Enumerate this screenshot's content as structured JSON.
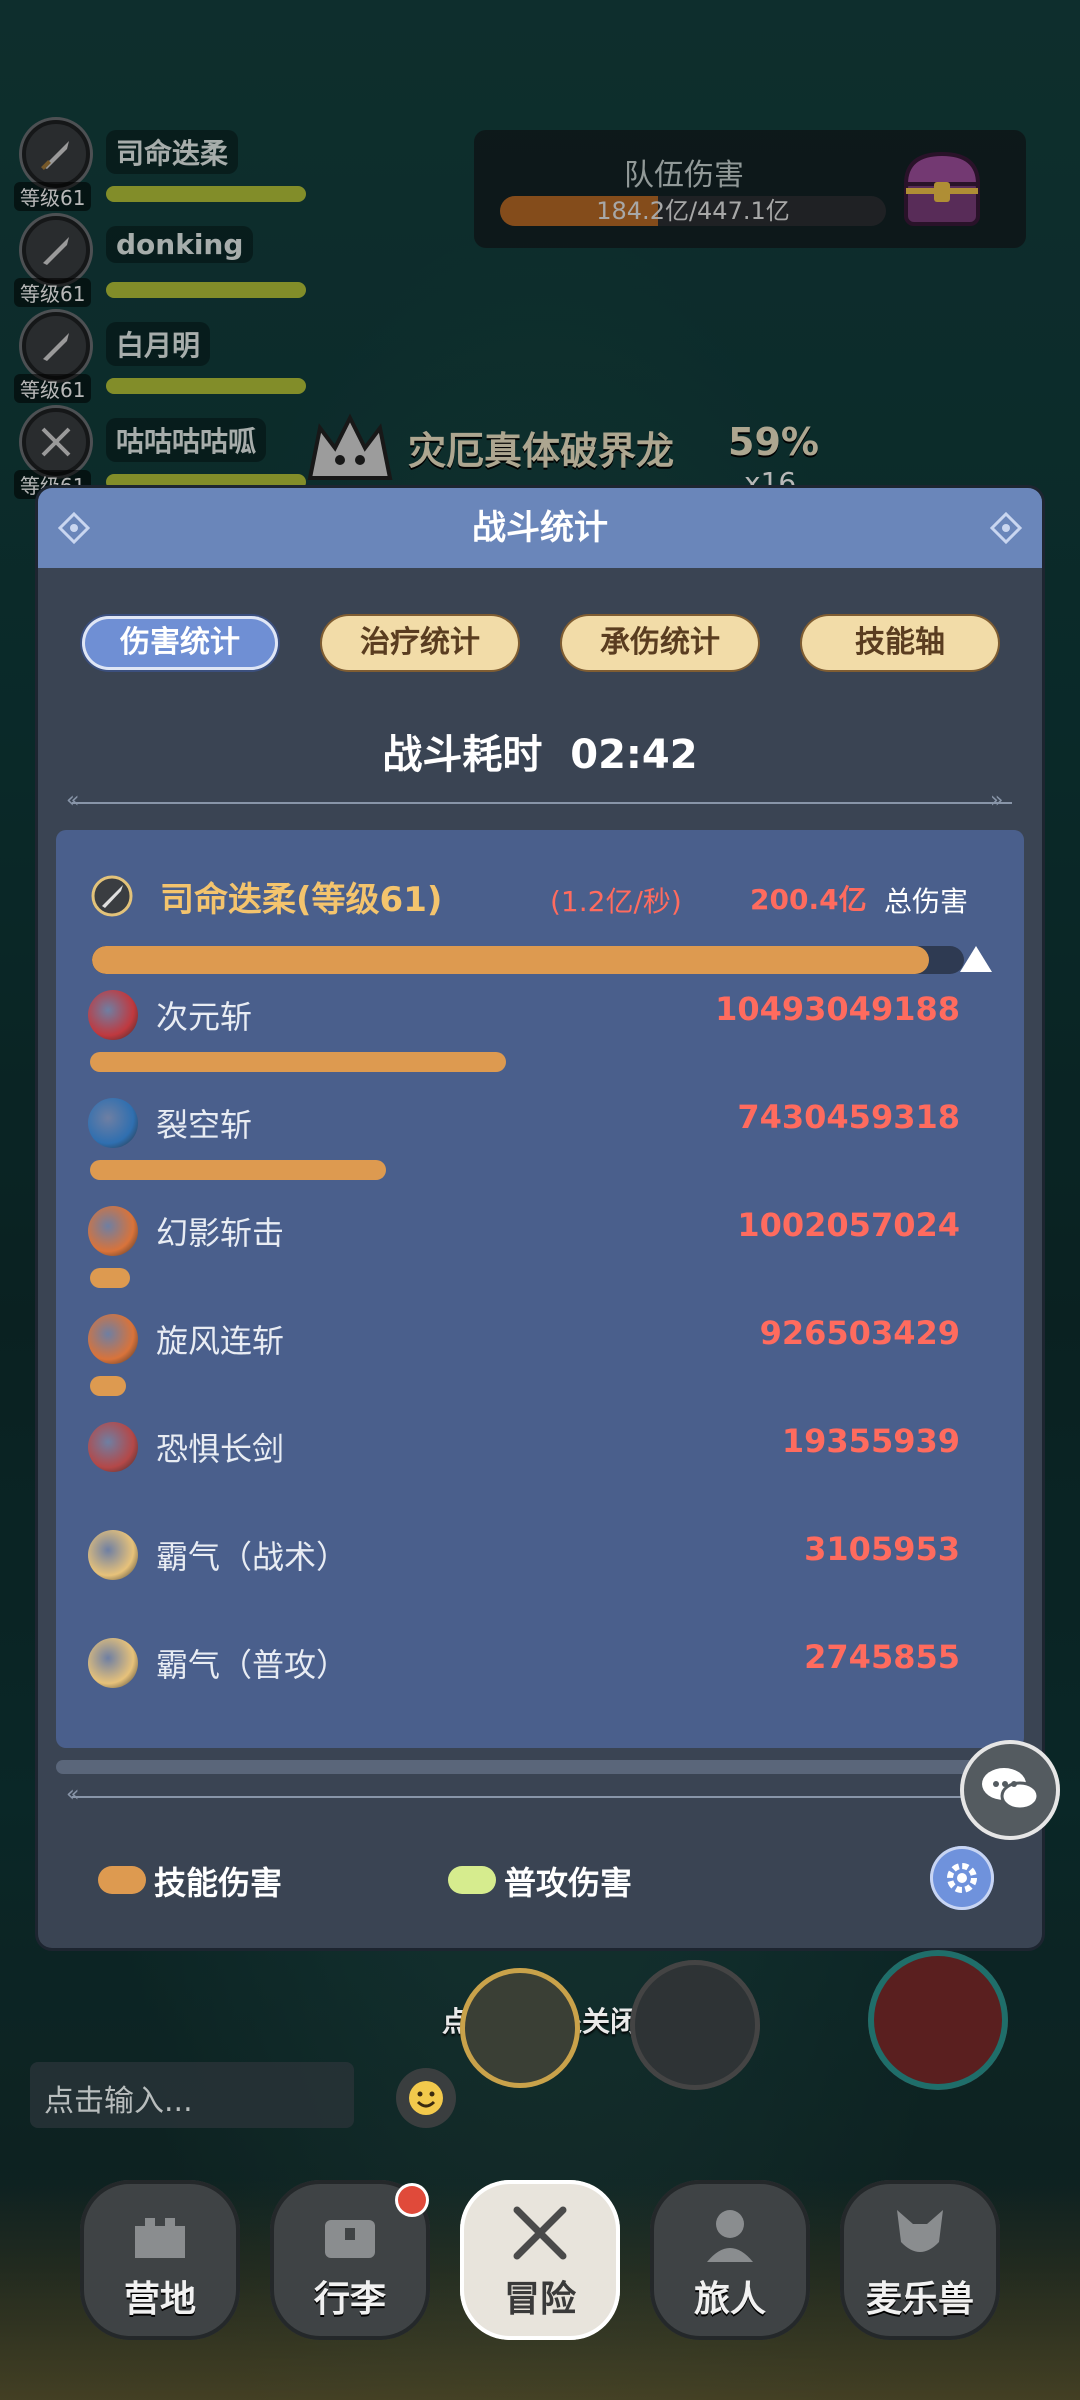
{
  "party": [
    {
      "name": "司命迭柔",
      "level": "等级61"
    },
    {
      "name": "donking",
      "level": "等级61"
    },
    {
      "name": "白月明",
      "level": "等级61"
    },
    {
      "name": "咕咕咕咕呱",
      "level": "等级61"
    }
  ],
  "team_damage": {
    "title": "队伍伤害",
    "value": "184.2亿/447.1亿",
    "progress": 0.41
  },
  "boss": {
    "name": "灾厄真体破界龙",
    "percent": "59%",
    "count": "x16"
  },
  "modal": {
    "title": "战斗统计",
    "tabs": [
      {
        "label": "伤害统计",
        "active": true
      },
      {
        "label": "治疗统计",
        "active": false
      },
      {
        "label": "承伤统计",
        "active": false
      },
      {
        "label": "技能轴",
        "active": false
      }
    ],
    "duration_label": "战斗耗时",
    "duration_value": "02:42",
    "player": {
      "name": "司命迭柔(等级61)",
      "rate": "(1.2亿/秒)",
      "total": "200.4亿",
      "total_label": "总伤害",
      "progress": 0.96
    },
    "skills": [
      {
        "name": "次元斩",
        "value": "10493049188",
        "ratio": 0.52,
        "icon": "dimension-slash-icon"
      },
      {
        "name": "裂空斩",
        "value": "7430459318",
        "ratio": 0.37,
        "icon": "rift-slash-icon"
      },
      {
        "name": "幻影斩击",
        "value": "1002057024",
        "ratio": 0.05,
        "icon": "phantom-strike-icon"
      },
      {
        "name": "旋风连斩",
        "value": "926503429",
        "ratio": 0.045,
        "icon": "whirlwind-slash-icon"
      },
      {
        "name": "恐惧长剑",
        "value": "19355939",
        "ratio": 0,
        "icon": "dread-sword-icon"
      },
      {
        "name": "霸气（战术）",
        "value": "3105953",
        "ratio": 0,
        "icon": "dominance-tactic-icon"
      },
      {
        "name": "霸气（普攻）",
        "value": "2745855",
        "ratio": 0,
        "icon": "dominance-attack-icon"
      }
    ],
    "legend": [
      {
        "label": "技能伤害",
        "color": "#dd9a50"
      },
      {
        "label": "普攻伤害",
        "color": "#d6ec8e"
      }
    ]
  },
  "close_hint": "点击空白处关闭",
  "chat_input": {
    "placeholder": "点击输入..."
  },
  "nav": [
    {
      "label": "营地",
      "active": false
    },
    {
      "label": "行李",
      "active": false,
      "badge": true
    },
    {
      "label": "冒险",
      "active": true
    },
    {
      "label": "旅人",
      "active": false
    },
    {
      "label": "麦乐兽",
      "active": false
    }
  ],
  "colors": {
    "accent": "#6f8fd4",
    "damage_text": "#ff6b5e",
    "player_name": "#f4c46d",
    "modal_header": "#6a86ba"
  }
}
